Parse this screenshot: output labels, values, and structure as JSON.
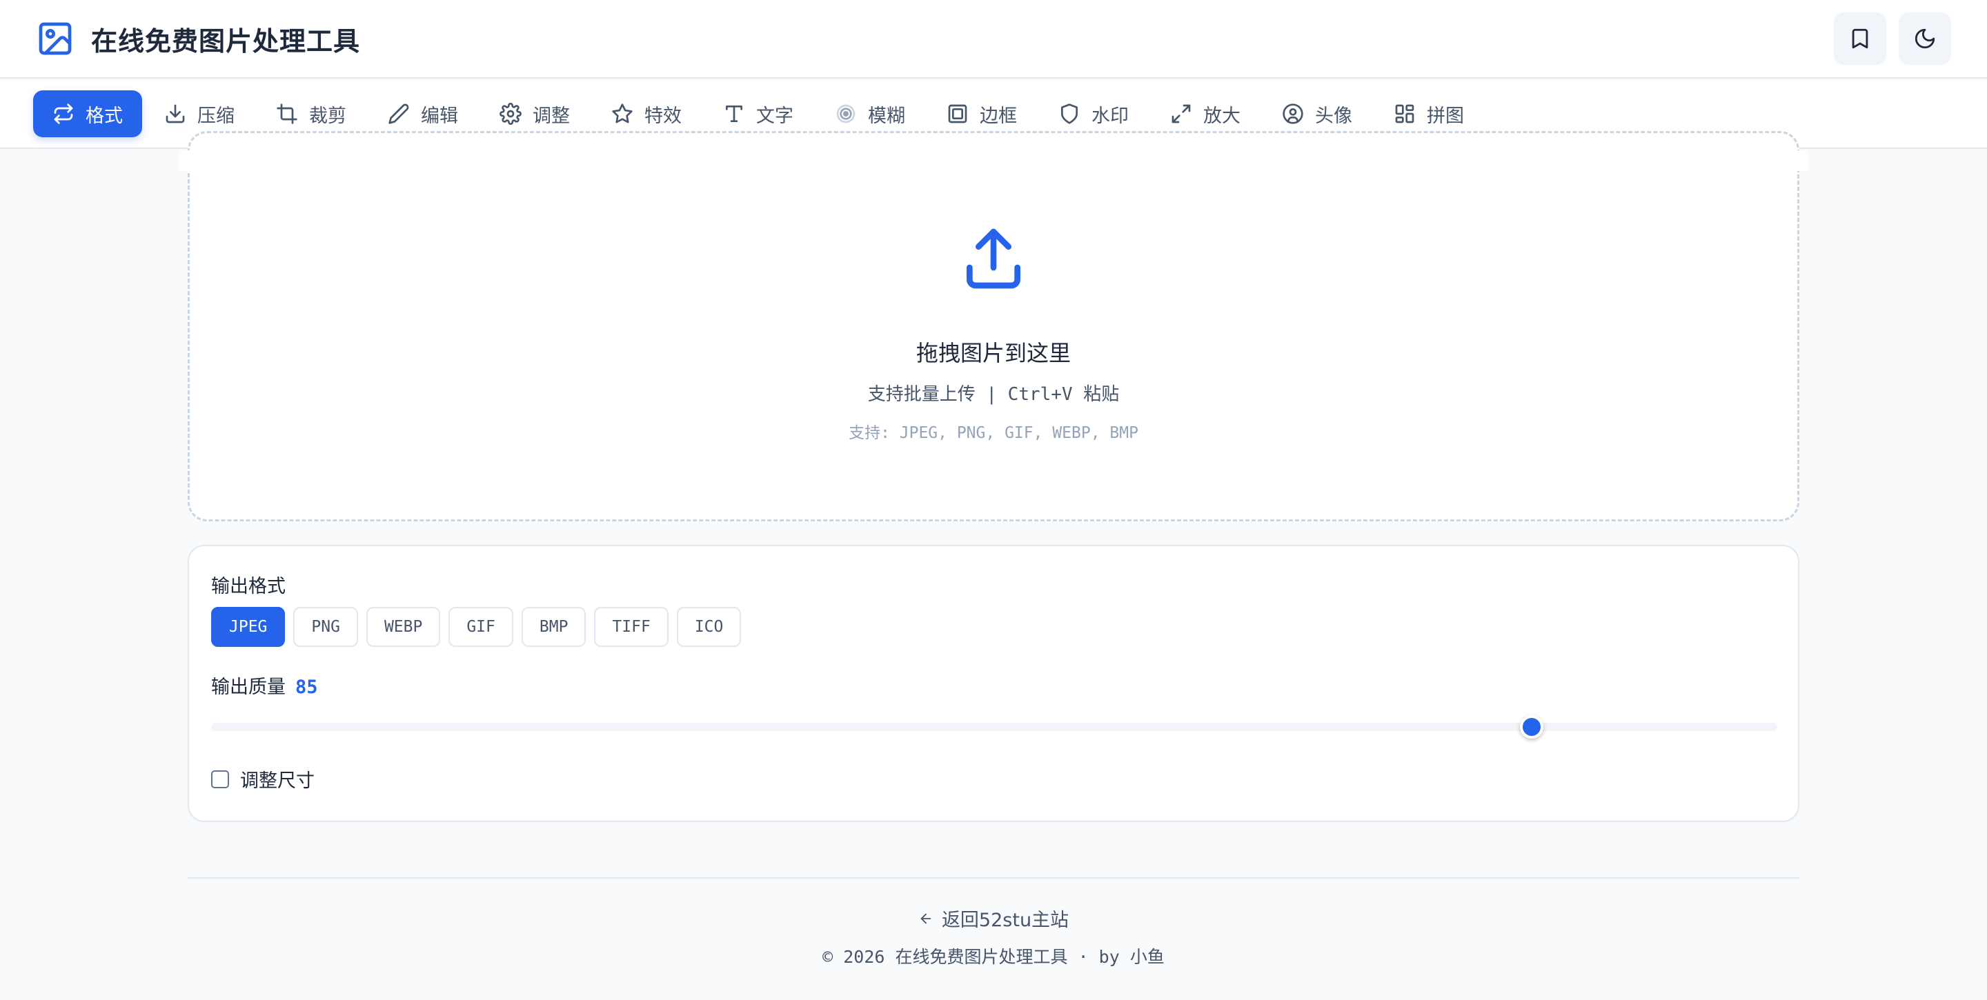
{
  "header": {
    "title": "在线免费图片处理工具",
    "logo_icon": "image-icon",
    "bookmark_icon": "bookmark-icon",
    "theme_icon": "moon-icon"
  },
  "nav": {
    "items": [
      {
        "label": "格式",
        "icon": "convert-icon",
        "active": true
      },
      {
        "label": "压缩",
        "icon": "download-icon"
      },
      {
        "label": "裁剪",
        "icon": "crop-icon"
      },
      {
        "label": "编辑",
        "icon": "pencil-icon"
      },
      {
        "label": "调整",
        "icon": "gear-icon"
      },
      {
        "label": "特效",
        "icon": "star-icon"
      },
      {
        "label": "文字",
        "icon": "text-icon"
      },
      {
        "label": "模糊",
        "icon": "blur-icon"
      },
      {
        "label": "边框",
        "icon": "frame-icon"
      },
      {
        "label": "水印",
        "icon": "shield-icon"
      },
      {
        "label": "放大",
        "icon": "expand-icon"
      },
      {
        "label": "头像",
        "icon": "avatar-icon"
      },
      {
        "label": "拼图",
        "icon": "grid-icon"
      }
    ]
  },
  "upload": {
    "icon": "upload-icon",
    "title": "拖拽图片到这里",
    "subtitle": "支持批量上传 | Ctrl+V 粘贴",
    "formats": "支持: JPEG, PNG, GIF, WEBP, BMP"
  },
  "settings": {
    "output_format_label": "输出格式",
    "formats": [
      {
        "label": "JPEG",
        "active": true
      },
      {
        "label": "PNG"
      },
      {
        "label": "WEBP"
      },
      {
        "label": "GIF"
      },
      {
        "label": "BMP"
      },
      {
        "label": "TIFF"
      },
      {
        "label": "ICO"
      }
    ],
    "quality_label": "输出质量",
    "quality_value": "85",
    "quality_fraction": 0.843,
    "resize_label": "调整尺寸",
    "resize_checked": false
  },
  "footer": {
    "back_icon": "arrow-left-icon",
    "back_link": "返回52stu主站",
    "copyright": "© 2026 在线免费图片处理工具 · by 小鱼"
  },
  "colors": {
    "accent": "#2563eb",
    "background": "#f8fafc"
  }
}
